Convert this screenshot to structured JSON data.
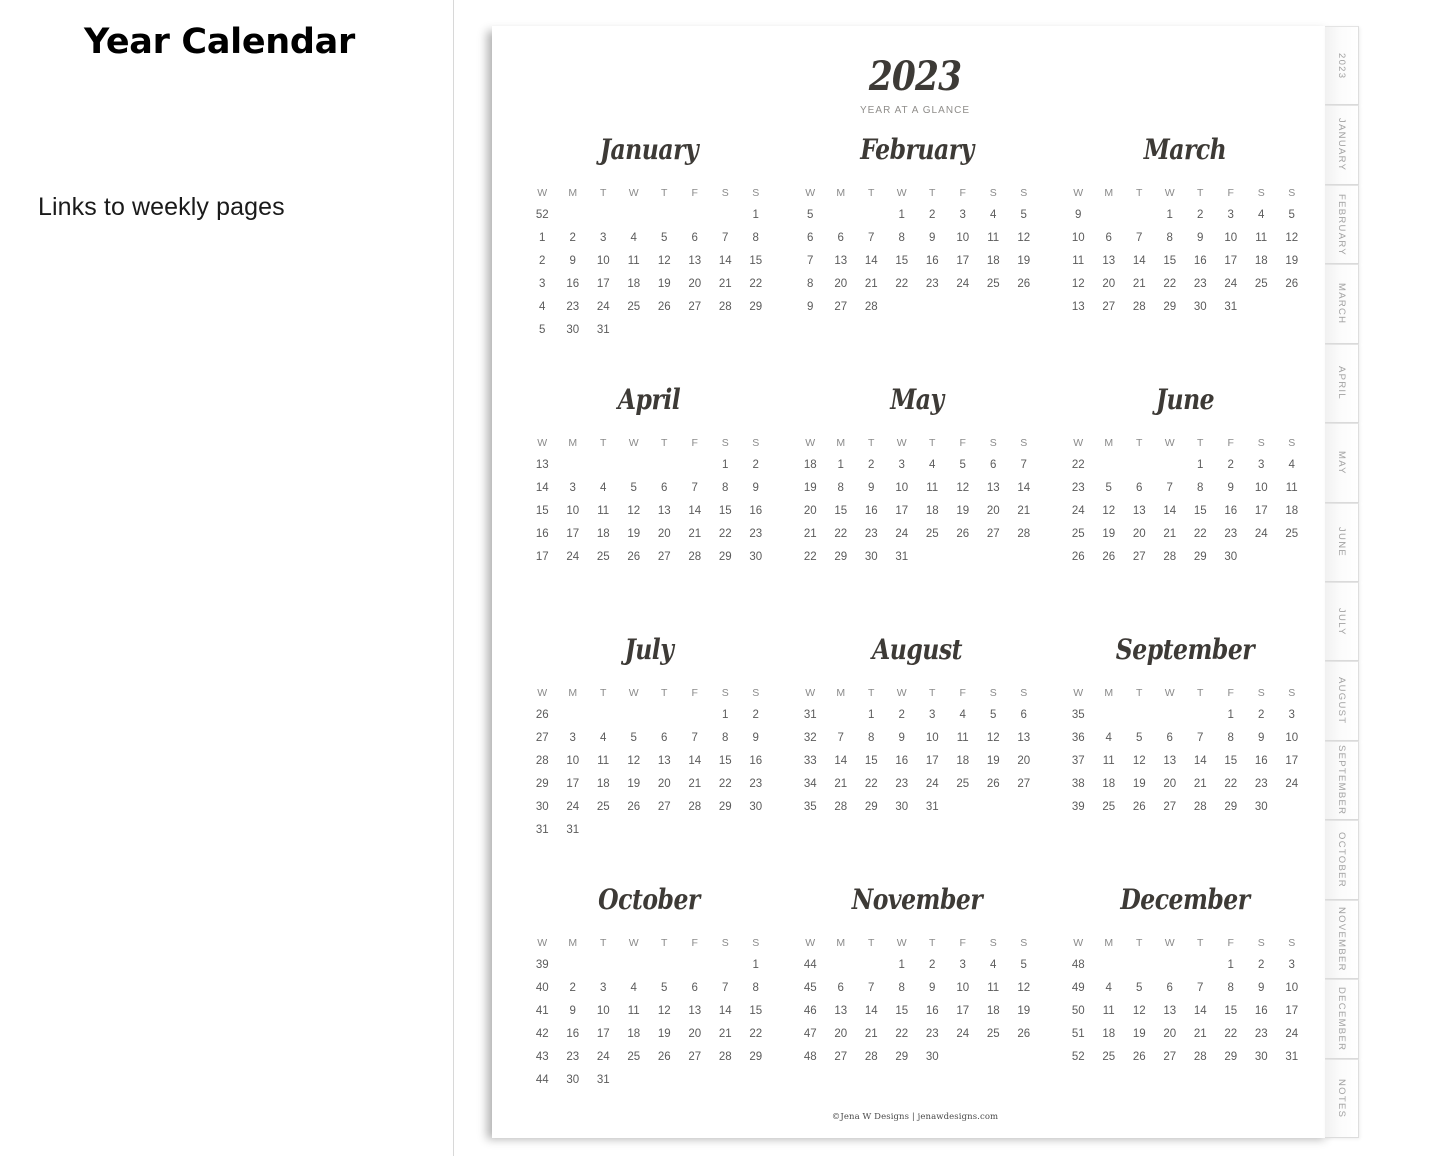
{
  "left_panel": {
    "title": "Year Calendar",
    "subtitle": "Links to weekly pages"
  },
  "sheet": {
    "year": "2023",
    "subtitle": "YEAR AT A GLANCE",
    "footer": "©Jena W Designs | jenawdesigns.com",
    "weekday_headers": [
      "W",
      "M",
      "T",
      "W",
      "T",
      "F",
      "S",
      "S"
    ]
  },
  "colors": {
    "heading": "#3d3a36",
    "day_number": "#5b5b5b",
    "weekday_header": "#8a8a8a",
    "tab_label": "#a2a2a2",
    "divider": "#d8d8d8"
  },
  "tabs": [
    {
      "label": "2023"
    },
    {
      "label": "JANUARY"
    },
    {
      "label": "FEBRUARY"
    },
    {
      "label": "MARCH"
    },
    {
      "label": "APRIL"
    },
    {
      "label": "MAY"
    },
    {
      "label": "JUNE"
    },
    {
      "label": "JULY"
    },
    {
      "label": "AUGUST"
    },
    {
      "label": "SEPTEMBER"
    },
    {
      "label": "OCTOBER"
    },
    {
      "label": "NOVEMBER"
    },
    {
      "label": "DECEMBER"
    },
    {
      "label": "NOTES"
    }
  ],
  "months": [
    {
      "name": "January",
      "rows": [
        [
          "52",
          "",
          "",
          "",
          "",
          "",
          "",
          "1"
        ],
        [
          "1",
          "2",
          "3",
          "4",
          "5",
          "6",
          "7",
          "8"
        ],
        [
          "2",
          "9",
          "10",
          "11",
          "12",
          "13",
          "14",
          "15"
        ],
        [
          "3",
          "16",
          "17",
          "18",
          "19",
          "20",
          "21",
          "22"
        ],
        [
          "4",
          "23",
          "24",
          "25",
          "26",
          "27",
          "28",
          "29"
        ],
        [
          "5",
          "30",
          "31",
          "",
          "",
          "",
          "",
          ""
        ]
      ]
    },
    {
      "name": "February",
      "rows": [
        [
          "5",
          "",
          "",
          "1",
          "2",
          "3",
          "4",
          "5"
        ],
        [
          "6",
          "6",
          "7",
          "8",
          "9",
          "10",
          "11",
          "12"
        ],
        [
          "7",
          "13",
          "14",
          "15",
          "16",
          "17",
          "18",
          "19"
        ],
        [
          "8",
          "20",
          "21",
          "22",
          "23",
          "24",
          "25",
          "26"
        ],
        [
          "9",
          "27",
          "28",
          "",
          "",
          "",
          "",
          ""
        ]
      ]
    },
    {
      "name": "March",
      "rows": [
        [
          "9",
          "",
          "",
          "1",
          "2",
          "3",
          "4",
          "5"
        ],
        [
          "10",
          "6",
          "7",
          "8",
          "9",
          "10",
          "11",
          "12"
        ],
        [
          "11",
          "13",
          "14",
          "15",
          "16",
          "17",
          "18",
          "19"
        ],
        [
          "12",
          "20",
          "21",
          "22",
          "23",
          "24",
          "25",
          "26"
        ],
        [
          "13",
          "27",
          "28",
          "29",
          "30",
          "31",
          "",
          ""
        ]
      ]
    },
    {
      "name": "April",
      "rows": [
        [
          "13",
          "",
          "",
          "",
          "",
          "",
          "1",
          "2"
        ],
        [
          "14",
          "3",
          "4",
          "5",
          "6",
          "7",
          "8",
          "9"
        ],
        [
          "15",
          "10",
          "11",
          "12",
          "13",
          "14",
          "15",
          "16"
        ],
        [
          "16",
          "17",
          "18",
          "19",
          "20",
          "21",
          "22",
          "23"
        ],
        [
          "17",
          "24",
          "25",
          "26",
          "27",
          "28",
          "29",
          "30"
        ]
      ]
    },
    {
      "name": "May",
      "rows": [
        [
          "18",
          "1",
          "2",
          "3",
          "4",
          "5",
          "6",
          "7"
        ],
        [
          "19",
          "8",
          "9",
          "10",
          "11",
          "12",
          "13",
          "14"
        ],
        [
          "20",
          "15",
          "16",
          "17",
          "18",
          "19",
          "20",
          "21"
        ],
        [
          "21",
          "22",
          "23",
          "24",
          "25",
          "26",
          "27",
          "28"
        ],
        [
          "22",
          "29",
          "30",
          "31",
          "",
          "",
          "",
          ""
        ]
      ]
    },
    {
      "name": "June",
      "rows": [
        [
          "22",
          "",
          "",
          "",
          "1",
          "2",
          "3",
          "4"
        ],
        [
          "23",
          "5",
          "6",
          "7",
          "8",
          "9",
          "10",
          "11"
        ],
        [
          "24",
          "12",
          "13",
          "14",
          "15",
          "16",
          "17",
          "18"
        ],
        [
          "25",
          "19",
          "20",
          "21",
          "22",
          "23",
          "24",
          "25"
        ],
        [
          "26",
          "26",
          "27",
          "28",
          "29",
          "30",
          "",
          ""
        ]
      ]
    },
    {
      "name": "July",
      "rows": [
        [
          "26",
          "",
          "",
          "",
          "",
          "",
          "1",
          "2"
        ],
        [
          "27",
          "3",
          "4",
          "5",
          "6",
          "7",
          "8",
          "9"
        ],
        [
          "28",
          "10",
          "11",
          "12",
          "13",
          "14",
          "15",
          "16"
        ],
        [
          "29",
          "17",
          "18",
          "19",
          "20",
          "21",
          "22",
          "23"
        ],
        [
          "30",
          "24",
          "25",
          "26",
          "27",
          "28",
          "29",
          "30"
        ],
        [
          "31",
          "31",
          "",
          "",
          "",
          "",
          "",
          ""
        ]
      ]
    },
    {
      "name": "August",
      "rows": [
        [
          "31",
          "",
          "1",
          "2",
          "3",
          "4",
          "5",
          "6"
        ],
        [
          "32",
          "7",
          "8",
          "9",
          "10",
          "11",
          "12",
          "13"
        ],
        [
          "33",
          "14",
          "15",
          "16",
          "17",
          "18",
          "19",
          "20"
        ],
        [
          "34",
          "21",
          "22",
          "23",
          "24",
          "25",
          "26",
          "27"
        ],
        [
          "35",
          "28",
          "29",
          "30",
          "31",
          "",
          "",
          ""
        ]
      ]
    },
    {
      "name": "September",
      "rows": [
        [
          "35",
          "",
          "",
          "",
          "",
          "1",
          "2",
          "3"
        ],
        [
          "36",
          "4",
          "5",
          "6",
          "7",
          "8",
          "9",
          "10"
        ],
        [
          "37",
          "11",
          "12",
          "13",
          "14",
          "15",
          "16",
          "17"
        ],
        [
          "38",
          "18",
          "19",
          "20",
          "21",
          "22",
          "23",
          "24"
        ],
        [
          "39",
          "25",
          "26",
          "27",
          "28",
          "29",
          "30",
          ""
        ]
      ]
    },
    {
      "name": "October",
      "rows": [
        [
          "39",
          "",
          "",
          "",
          "",
          "",
          "",
          "1"
        ],
        [
          "40",
          "2",
          "3",
          "4",
          "5",
          "6",
          "7",
          "8"
        ],
        [
          "41",
          "9",
          "10",
          "11",
          "12",
          "13",
          "14",
          "15"
        ],
        [
          "42",
          "16",
          "17",
          "18",
          "19",
          "20",
          "21",
          "22"
        ],
        [
          "43",
          "23",
          "24",
          "25",
          "26",
          "27",
          "28",
          "29"
        ],
        [
          "44",
          "30",
          "31",
          "",
          "",
          "",
          "",
          ""
        ]
      ]
    },
    {
      "name": "November",
      "rows": [
        [
          "44",
          "",
          "",
          "1",
          "2",
          "3",
          "4",
          "5"
        ],
        [
          "45",
          "6",
          "7",
          "8",
          "9",
          "10",
          "11",
          "12"
        ],
        [
          "46",
          "13",
          "14",
          "15",
          "16",
          "17",
          "18",
          "19"
        ],
        [
          "47",
          "20",
          "21",
          "22",
          "23",
          "24",
          "25",
          "26"
        ],
        [
          "48",
          "27",
          "28",
          "29",
          "30",
          "",
          "",
          ""
        ]
      ]
    },
    {
      "name": "December",
      "rows": [
        [
          "48",
          "",
          "",
          "",
          "",
          "1",
          "2",
          "3"
        ],
        [
          "49",
          "4",
          "5",
          "6",
          "7",
          "8",
          "9",
          "10"
        ],
        [
          "50",
          "11",
          "12",
          "13",
          "14",
          "15",
          "16",
          "17"
        ],
        [
          "51",
          "18",
          "19",
          "20",
          "21",
          "22",
          "23",
          "24"
        ],
        [
          "52",
          "25",
          "26",
          "27",
          "28",
          "29",
          "30",
          "31"
        ]
      ]
    }
  ]
}
